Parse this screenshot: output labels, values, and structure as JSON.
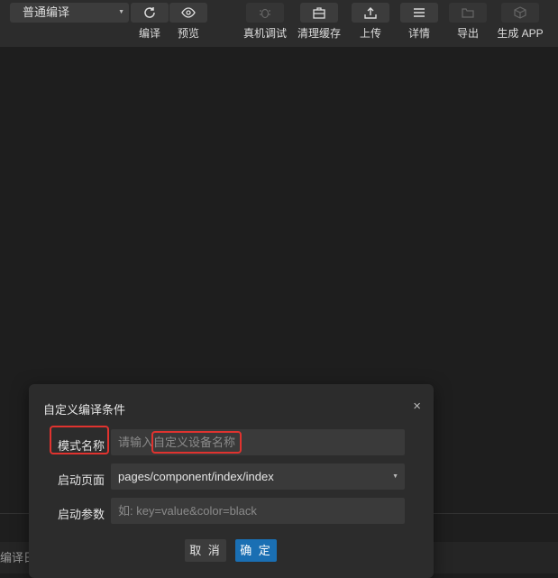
{
  "toolbar": {
    "mode": "普通编译",
    "compile": "编译",
    "preview": "预览",
    "real_debug": "真机调试",
    "clear_cache": "清理缓存",
    "upload": "上传",
    "details": "详情",
    "export": "导出",
    "generate_app": "生成 APP"
  },
  "bottom": {
    "partial_text": "编译日"
  },
  "dialog": {
    "title": "自定义编译条件",
    "close": "×",
    "mode_name_label": "模式名称",
    "mode_name_placeholder_a": "请输入",
    "mode_name_placeholder_b": "自定义设备名称",
    "start_page_label": "启动页面",
    "start_page_value": "pages/component/index/index",
    "start_params_label": "启动参数",
    "start_params_placeholder": "如: key=value&color=black",
    "cancel": "取 消",
    "confirm": "确 定"
  },
  "colors": {
    "accent": "#1a6fb3",
    "highlight": "#e0332f"
  }
}
